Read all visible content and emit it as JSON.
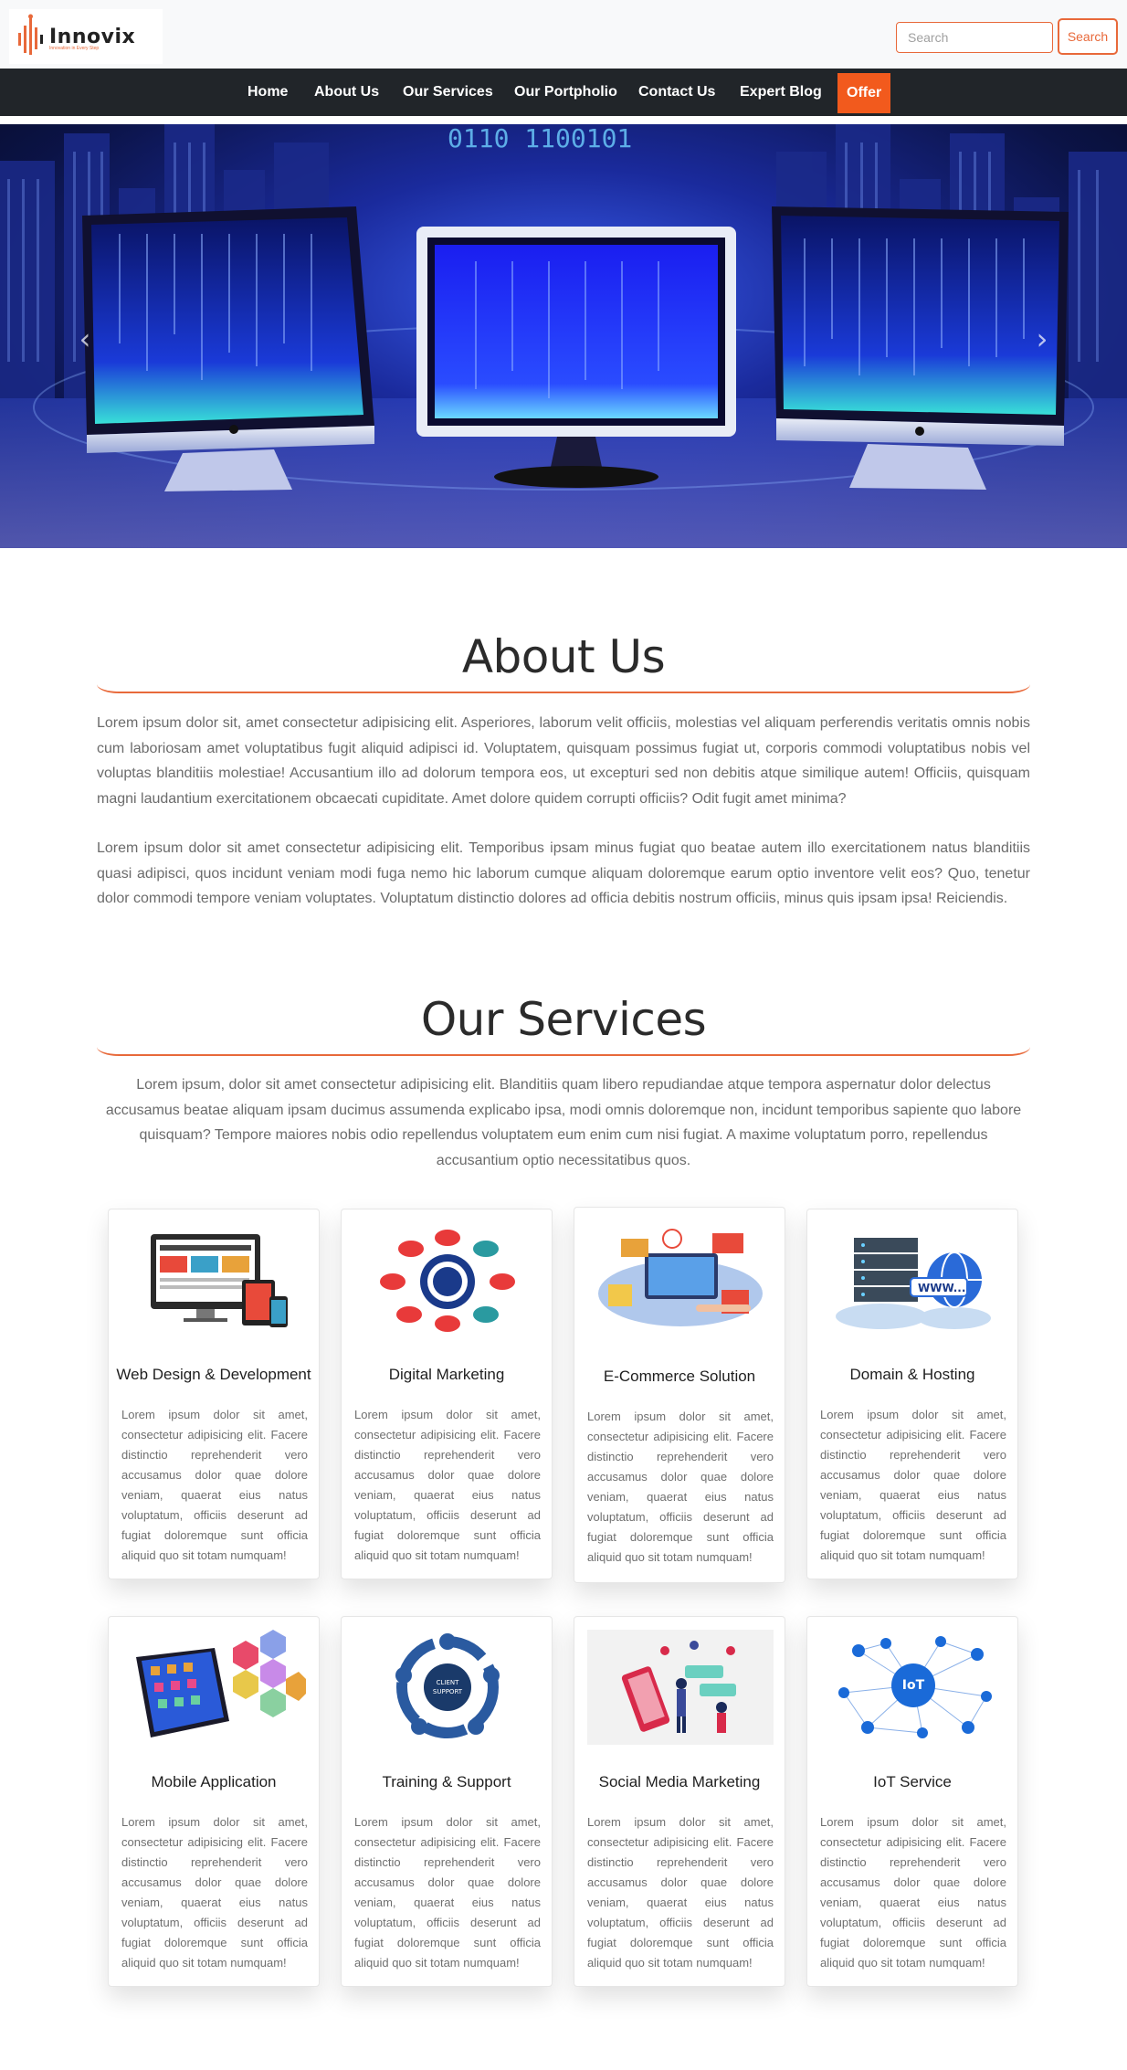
{
  "brand": {
    "name": "Innovix",
    "tagline": "Innovation in Every Step"
  },
  "search": {
    "placeholder": "Search",
    "button_label": "Search"
  },
  "nav": {
    "items": [
      {
        "label": "Home"
      },
      {
        "label": "About Us"
      },
      {
        "label": "Our Services"
      },
      {
        "label": "Our Portpholio"
      },
      {
        "label": "Contact Us"
      },
      {
        "label": "Expert Blog"
      },
      {
        "label": "Offer"
      }
    ]
  },
  "hero": {
    "binary_text": "0110 1100101",
    "prev_icon": "chevron-left-icon",
    "next_icon": "chevron-right-icon"
  },
  "about": {
    "title": "About Us",
    "paragraphs": [
      "Lorem ipsum dolor sit, amet consectetur adipisicing elit. Asperiores, laborum velit officiis, molestias vel aliquam perferendis veritatis omnis nobis cum laboriosam amet voluptatibus fugit aliquid adipisci id. Voluptatem, quisquam possimus fugiat ut, corporis commodi voluptatibus nobis vel voluptas blanditiis molestiae! Accusantium illo ad dolorum tempora eos, ut excepturi sed non debitis atque similique autem! Officiis, quisquam magni laudantium exercitationem obcaecati cupiditate. Amet dolore quidem corrupti officiis? Odit fugit amet minima?",
      "Lorem ipsum dolor sit amet consectetur adipisicing elit. Temporibus ipsam minus fugiat quo beatae autem illo exercitationem natus blanditiis quasi adipisci, quos incidunt veniam modi fuga nemo hic laborum cumque aliquam doloremque earum optio inventore velit eos? Quo, tenetur dolor commodi tempore veniam voluptates. Voluptatum distinctio dolores ad officia debitis nostrum officiis, minus quis ipsam ipsa! Reiciendis."
    ]
  },
  "services": {
    "title": "Our Services",
    "intro": "Lorem ipsum, dolor sit amet consectetur adipisicing elit. Blanditiis quam libero repudiandae atque tempora aspernatur dolor delectus accusamus beatae aliquam ipsam ducimus assumenda explicabo ipsa, modi omnis doloremque non, incidunt temporibus sapiente quo labore quisquam? Tempore maiores nobis odio repellendus voluptatem eum enim cum nisi fugiat. A maxime voluptatum porro, repellendus accusantium optio necessitatibus quos.",
    "card_text": "Lorem ipsum dolor sit amet, consectetur adipisicing elit. Facere distinctio reprehenderit vero accusamus dolor quae dolore veniam, quaerat eius natus voluptatum, officiis deserunt ad fugiat doloremque sunt officia aliquid quo sit totam numquam!",
    "cards": [
      {
        "title": "Web Design & Development",
        "icon": "devices-icon"
      },
      {
        "title": "Digital Marketing",
        "icon": "marketing-icon"
      },
      {
        "title": "E-Commerce Solution",
        "icon": "shopping-icon"
      },
      {
        "title": "Domain & Hosting",
        "icon": "server-globe-icon"
      },
      {
        "title": "Mobile Application",
        "icon": "smartphone-icon"
      },
      {
        "title": "Training & Support",
        "icon": "support-icon"
      },
      {
        "title": "Social Media Marketing",
        "icon": "social-media-icon"
      },
      {
        "title": "IoT Service",
        "icon": "iot-icon"
      }
    ]
  },
  "colors": {
    "accent": "#e8693a",
    "nav_bg": "#212529",
    "offer_bg": "#f25a1d"
  }
}
